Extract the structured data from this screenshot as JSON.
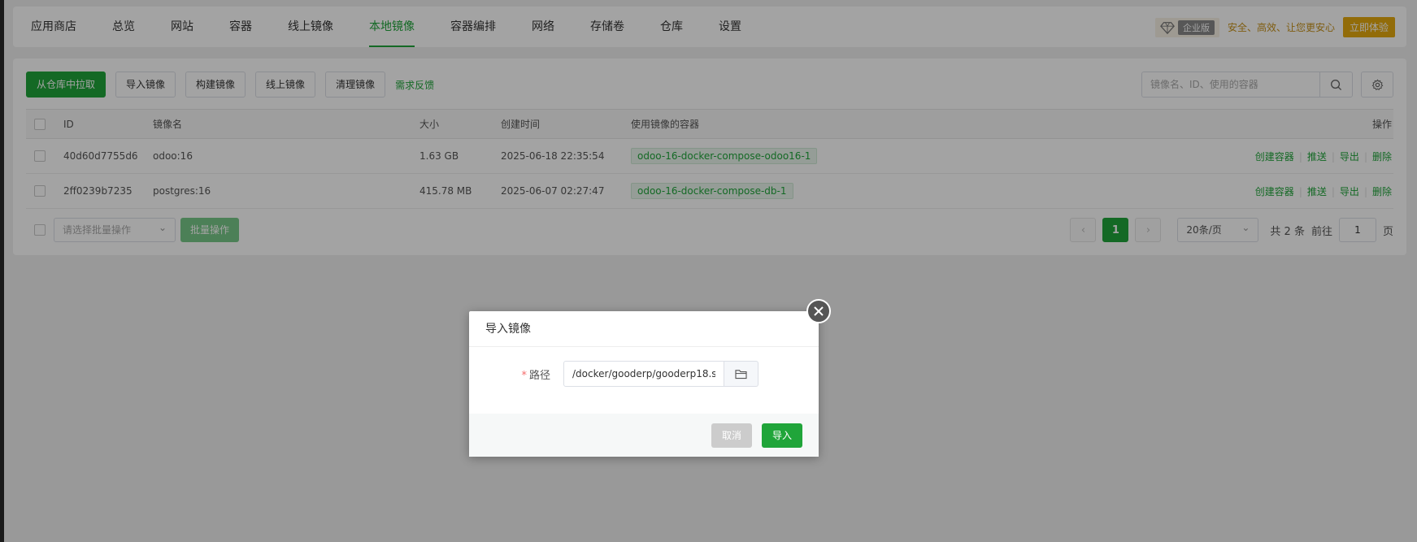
{
  "nav": {
    "tabs": [
      "应用商店",
      "总览",
      "网站",
      "容器",
      "线上镜像",
      "本地镜像",
      "容器编排",
      "网络",
      "存储卷",
      "仓库",
      "设置"
    ],
    "active_index": 5,
    "enterprise_label": "企业版",
    "slogan": "安全、高效、让您更安心",
    "try_label": "立即体验"
  },
  "toolbar": {
    "pull_label": "从仓库中拉取",
    "import_label": "导入镜像",
    "build_label": "构建镜像",
    "online_label": "线上镜像",
    "clean_label": "清理镜像",
    "feedback_label": "需求反馈",
    "search_placeholder": "镜像名、ID、使用的容器"
  },
  "table": {
    "headers": [
      "ID",
      "镜像名",
      "大小",
      "创建时间",
      "使用镜像的容器",
      "操作"
    ],
    "rows": [
      {
        "id": "40d60d7755d6",
        "name": "odoo:16",
        "size": "1.63 GB",
        "created": "2025-06-18 22:35:54",
        "container": "odoo-16-docker-compose-odoo16-1"
      },
      {
        "id": "2ff0239b7235",
        "name": "postgres:16",
        "size": "415.78 MB",
        "created": "2025-06-07 02:27:47",
        "container": "odoo-16-docker-compose-db-1"
      }
    ],
    "ops": [
      "创建容器",
      "推送",
      "导出",
      "删除"
    ]
  },
  "footer": {
    "bulk_placeholder": "请选择批量操作",
    "bulk_label": "批量操作",
    "current_page": "1",
    "page_size": "20条/页",
    "total": "共 2 条",
    "goto": "前往",
    "goto_value": "1",
    "page_unit": "页"
  },
  "dialog": {
    "title": "导入镜像",
    "field_required": "*",
    "field_label": "路径",
    "path_value": "/docker/gooderp/gooderp18.s",
    "cancel_label": "取消",
    "ok_label": "导入"
  },
  "colors": {
    "accent": "#20a53a",
    "gold": "#e5a90f"
  }
}
